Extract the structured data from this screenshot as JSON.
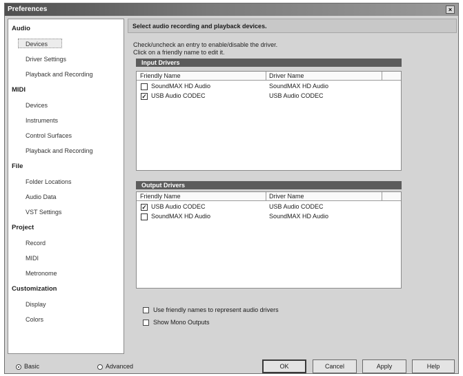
{
  "window": {
    "title": "Preferences",
    "close_label": "×"
  },
  "sidebar": {
    "categories": [
      {
        "label": "Audio",
        "items": [
          "Devices",
          "Driver Settings",
          "Playback and Recording"
        ]
      },
      {
        "label": "MIDI",
        "items": [
          "Devices",
          "Instruments",
          "Control Surfaces",
          "Playback and Recording"
        ]
      },
      {
        "label": "File",
        "items": [
          "Folder Locations",
          "Audio Data",
          "VST Settings"
        ]
      },
      {
        "label": "Project",
        "items": [
          "Record",
          "MIDI",
          "Metronome"
        ]
      },
      {
        "label": "Customization",
        "items": [
          "Display",
          "Colors"
        ]
      }
    ],
    "selected": "Devices"
  },
  "main": {
    "header": "Select audio recording and playback devices.",
    "instruction_line1": "Check/uncheck an entry to enable/disable the driver.",
    "instruction_line2": "Click on a friendly name to edit it.",
    "input_drivers": {
      "title": "Input Drivers",
      "columns": [
        "Friendly Name",
        "Driver Name"
      ],
      "rows": [
        {
          "checked": false,
          "friendly": "SoundMAX HD Audio",
          "driver": "SoundMAX HD Audio"
        },
        {
          "checked": true,
          "friendly": "USB Audio CODEC",
          "driver": "USB Audio CODEC"
        }
      ]
    },
    "output_drivers": {
      "title": "Output Drivers",
      "columns": [
        "Friendly Name",
        "Driver Name"
      ],
      "rows": [
        {
          "checked": true,
          "friendly": "USB Audio CODEC",
          "driver": "USB Audio CODEC"
        },
        {
          "checked": false,
          "friendly": "SoundMAX HD Audio",
          "driver": "SoundMAX HD Audio"
        }
      ]
    },
    "options": {
      "friendly_names": "Use friendly names to represent audio drivers",
      "mono_outputs": "Show Mono Outputs"
    }
  },
  "footer": {
    "basic_label": "Basic",
    "advanced_label": "Advanced",
    "mode": "Basic",
    "ok_label": "OK",
    "cancel_label": "Cancel",
    "apply_label": "Apply",
    "help_label": "Help"
  }
}
